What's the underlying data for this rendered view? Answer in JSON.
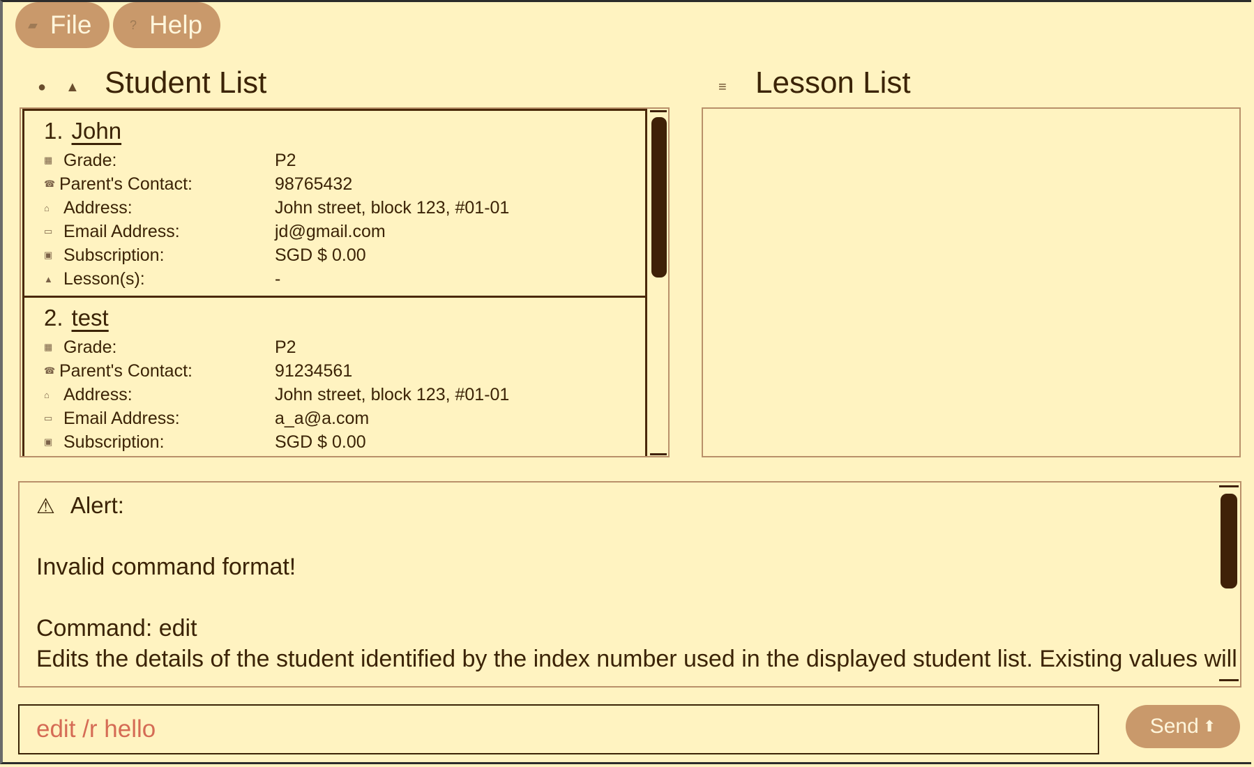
{
  "menu": {
    "file_label": "File",
    "help_label": "Help",
    "file_icon": "folder-icon",
    "help_icon": "help-icon"
  },
  "student_panel": {
    "title": "Student List",
    "students": [
      {
        "index": "1.",
        "name": "John",
        "fields": [
          {
            "label": "Grade:",
            "value": "P2",
            "icon": "grade-icon"
          },
          {
            "label": "Parent's Contact:",
            "value": "98765432",
            "icon": "phone-icon"
          },
          {
            "label": "Address:",
            "value": "John street, block 123, #01-01",
            "icon": "home-icon"
          },
          {
            "label": "Email Address:",
            "value": "jd@gmail.com",
            "icon": "email-icon"
          },
          {
            "label": "Subscription:",
            "value": "SGD $ 0.00",
            "icon": "money-icon"
          },
          {
            "label": "Lesson(s):",
            "value": "-",
            "icon": "lesson-icon"
          }
        ]
      },
      {
        "index": "2.",
        "name": "test",
        "fields": [
          {
            "label": "Grade:",
            "value": "P2",
            "icon": "grade-icon"
          },
          {
            "label": "Parent's Contact:",
            "value": "91234561",
            "icon": "phone-icon"
          },
          {
            "label": "Address:",
            "value": "John street, block 123, #01-01",
            "icon": "home-icon"
          },
          {
            "label": "Email Address:",
            "value": "a_a@a.com",
            "icon": "email-icon"
          },
          {
            "label": "Subscription:",
            "value": "SGD $ 0.00",
            "icon": "money-icon"
          }
        ]
      }
    ]
  },
  "lesson_panel": {
    "title": "Lesson List"
  },
  "alert": {
    "heading": "Alert:",
    "message": "Invalid command format!",
    "command_line": "Command: edit",
    "description": "Edits the details of the student identified by the index number used in the displayed student list. Existing values will"
  },
  "command": {
    "value": "edit /r hello"
  },
  "send": {
    "label": "Send"
  },
  "colors": {
    "background": "#fff3c1",
    "accent": "#c9996b",
    "text": "#3b2306",
    "command_text": "#d56b55"
  }
}
